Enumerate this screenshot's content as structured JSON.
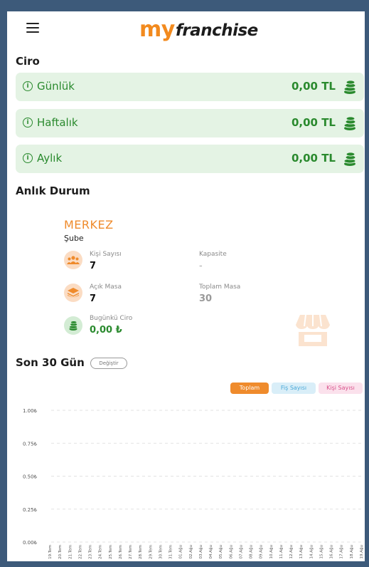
{
  "header": {
    "logo_my": "my",
    "logo_franchise": "franchise"
  },
  "ciro": {
    "title": "Ciro",
    "cards": [
      {
        "label": "Günlük",
        "amount": "0,00 TL"
      },
      {
        "label": "Haftalık",
        "amount": "0,00 TL"
      },
      {
        "label": "Aylık",
        "amount": "0,00 TL"
      }
    ]
  },
  "status": {
    "title": "Anlık Durum",
    "branch_name": "MERKEZ",
    "branch_type": "Şube",
    "stats": {
      "kisi_label": "Kişi Sayısı",
      "kisi_value": "7",
      "kapasite_label": "Kapasite",
      "kapasite_value": "-",
      "acik_label": "Açık Masa",
      "acik_value": "7",
      "toplam_label": "Toplam Masa",
      "toplam_value": "30",
      "ciro_label": "Bugünkü Ciro",
      "ciro_value": "0,00 ₺"
    }
  },
  "last30": {
    "title": "Son 30 Gün",
    "change_label": "Değiştir",
    "legend": [
      {
        "label": "Toplam",
        "bg": "#ef8b2c",
        "fg": "#ffffff"
      },
      {
        "label": "Fiş Sayısı",
        "bg": "#d9eef8",
        "fg": "#4aa8d8"
      },
      {
        "label": "Kişi Sayısı",
        "bg": "#fbe1ec",
        "fg": "#d8508a"
      }
    ]
  },
  "colors": {
    "accent_orange": "#ef8b2c",
    "green_text": "#2a8a2e",
    "card_green": "#e4f3e4"
  },
  "chart_data": {
    "type": "line",
    "y_ticks": [
      "1.00₺",
      "0.75₺",
      "0.50₺",
      "0.25₺",
      "0.00₺"
    ],
    "ylim": [
      0,
      1
    ],
    "categories": [
      "19.Tem",
      "20.Tem",
      "21.Tem",
      "22.Tem",
      "23.Tem",
      "24.Tem",
      "25.Tem",
      "26.Tem",
      "27.Tem",
      "28.Tem",
      "29.Tem",
      "30.Tem",
      "31.Tem",
      "01.Ağu",
      "02.Ağu",
      "03.Ağu",
      "04.Ağu",
      "05.Ağu",
      "06.Ağu",
      "07.Ağu",
      "08.Ağu",
      "09.Ağu",
      "10.Ağu",
      "11.Ağu",
      "12.Ağu",
      "13.Ağu",
      "14.Ağu",
      "15.Ağu",
      "16.Ağu",
      "17.Ağu",
      "18.Ağu",
      "19.Ağu"
    ],
    "series": [
      {
        "name": "Toplam",
        "values": [
          0,
          0,
          0,
          0,
          0,
          0,
          0,
          0,
          0,
          0,
          0,
          0,
          0,
          0,
          0,
          0,
          0,
          0,
          0,
          0,
          0,
          0,
          0,
          0,
          0,
          0,
          0,
          0,
          0,
          0,
          0,
          0
        ]
      }
    ],
    "grid": true
  }
}
